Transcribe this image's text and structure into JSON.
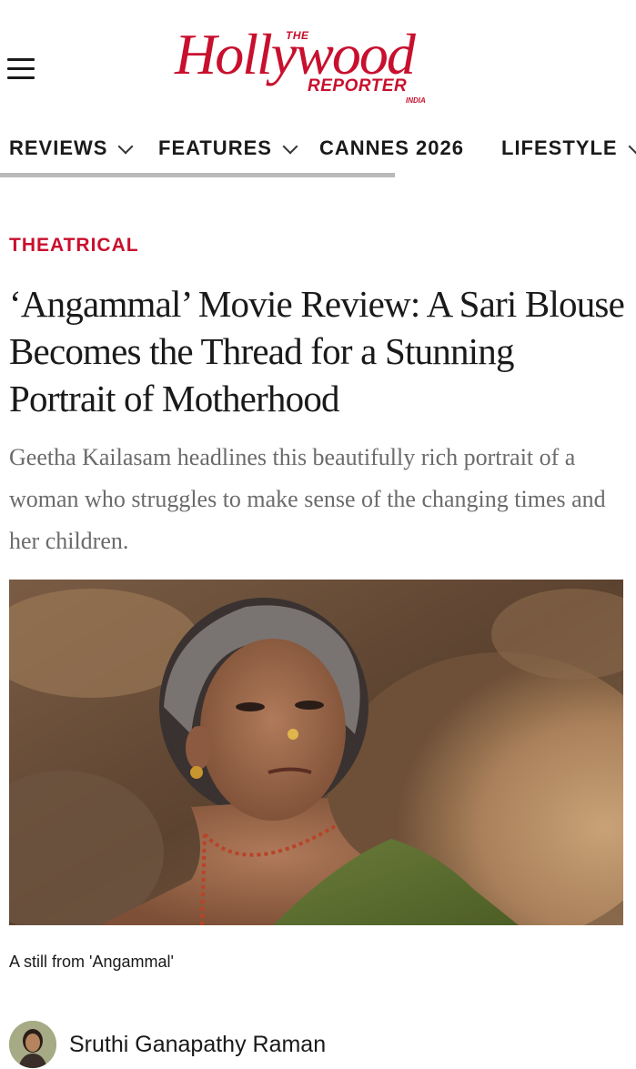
{
  "header": {
    "logo": {
      "the": "THE",
      "hollywood": "Hollywood",
      "reporter": "REPORTER",
      "india": "INDIA",
      "brand_color": "#c8102e"
    },
    "menu_icon": "hamburger-menu-icon"
  },
  "nav": {
    "items": [
      {
        "label": "REVIEWS",
        "has_dropdown": true
      },
      {
        "label": "FEATURES",
        "has_dropdown": true
      },
      {
        "label": "CANNES 2026",
        "has_dropdown": false
      },
      {
        "label": "LIFESTYLE",
        "has_dropdown": true
      }
    ]
  },
  "article": {
    "category": "THEATRICAL",
    "headline": "‘Angammal’ Movie Review: A Sari Blouse Becomes the Thread for a Stunning Portrait of Motherhood",
    "dek": "Geetha Kailasam headlines this beautifully rich portrait of a woman who struggles to make sense of the changing times and her children.",
    "image_caption": "A still from 'Angammal'",
    "author": "Sruthi Ganapathy Raman"
  },
  "colors": {
    "accent": "#c8102e",
    "dek_text": "#6b6b6b",
    "scrollbar": "#b9b9b9"
  }
}
